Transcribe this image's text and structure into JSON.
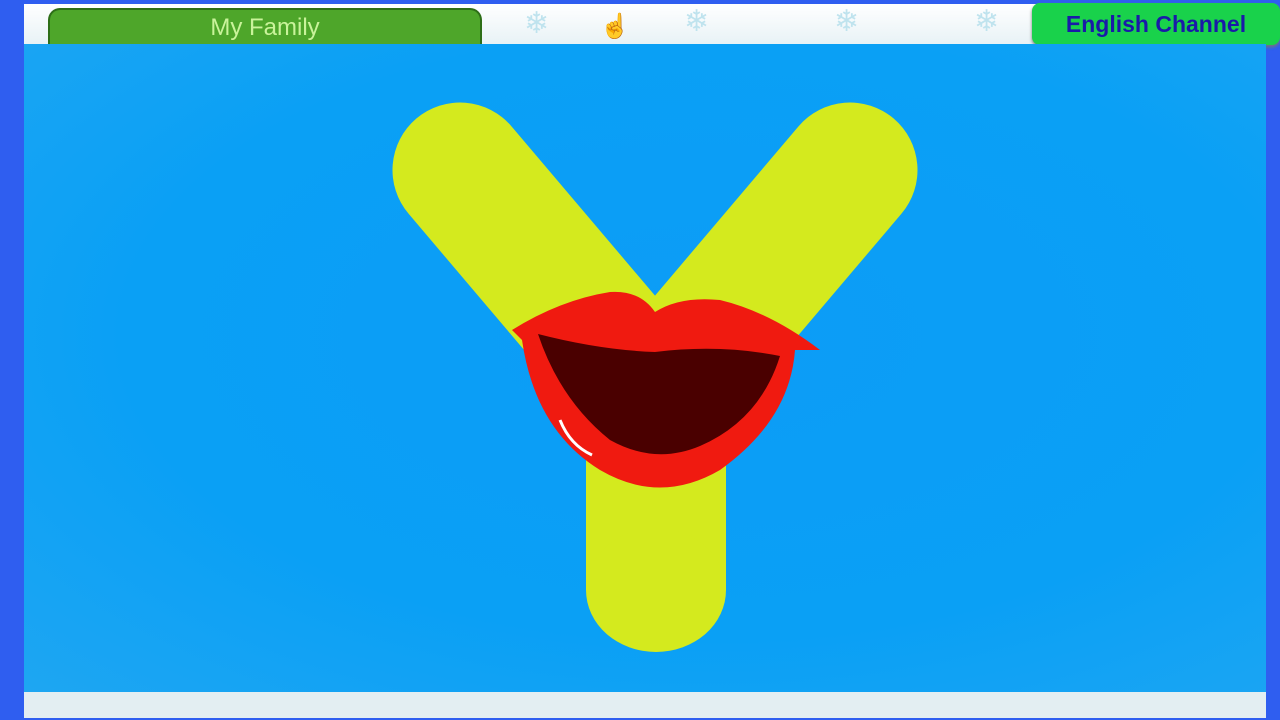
{
  "header": {
    "title": "My Family",
    "channel_button": "English Channel"
  },
  "scene": {
    "letter": "Y",
    "letter_color": "#d4ea1e",
    "lips_color": "#f01a10",
    "mouth_color": "#4a0000",
    "background_color": "#0aa0f5"
  }
}
